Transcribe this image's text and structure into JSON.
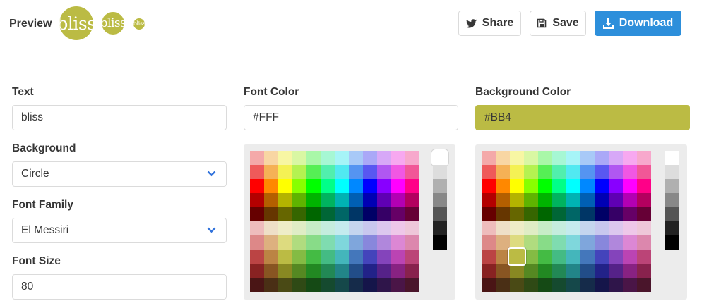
{
  "header": {
    "preview_label": "Preview",
    "avatar_text": "bliss",
    "share_label": "Share",
    "save_label": "Save",
    "download_label": "Download"
  },
  "text": {
    "label": "Text",
    "value": "bliss"
  },
  "background": {
    "label": "Background",
    "value": "Circle"
  },
  "font_family": {
    "label": "Font Family",
    "value": "El Messiri"
  },
  "font_size": {
    "label": "Font Size",
    "value": "80"
  },
  "font_color": {
    "label": "Font Color",
    "value": "#FFF"
  },
  "background_color": {
    "label": "Background Color",
    "value": "#BB4"
  },
  "colors": {
    "avatar_bg": "#bbbb44",
    "avatar_fg": "#ffffff",
    "download_button": "#2d8fdb"
  },
  "icons": {
    "share": "twitter-icon",
    "save": "floppy-disk-icon",
    "download": "download-icon",
    "select": "chevron-down-icon"
  },
  "palette": {
    "rows": [
      [
        "#f4a9a9",
        "#f8d6a3",
        "#f7f6a3",
        "#d9f7a3",
        "#a9f7a8",
        "#a6f7d4",
        "#a6f4f7",
        "#a8c9f7",
        "#aaa8f7",
        "#d7a8f7",
        "#f7a8f0",
        "#f7a8cc"
      ],
      [
        "#ef5a5a",
        "#f5b156",
        "#f4f154",
        "#b4f251",
        "#56ef55",
        "#51efad",
        "#51e9f1",
        "#5594f1",
        "#5957f1",
        "#b057f1",
        "#f157e3",
        "#f15797"
      ],
      [
        "#ff0000",
        "#ff8800",
        "#ffff00",
        "#88ff00",
        "#00ff00",
        "#00ff88",
        "#00ffff",
        "#0088ff",
        "#0000ff",
        "#8800ff",
        "#ff00ff",
        "#ff0088"
      ],
      [
        "#b30000",
        "#b35f00",
        "#b3b300",
        "#5fb300",
        "#00b300",
        "#00b35f",
        "#00b3b3",
        "#005fb3",
        "#0000b3",
        "#5f00b3",
        "#b300b3",
        "#b3005f"
      ],
      [
        "#660000",
        "#663600",
        "#666600",
        "#366600",
        "#006600",
        "#006636",
        "#006666",
        "#003666",
        "#000066",
        "#360066",
        "#660066",
        "#660036"
      ],
      [
        "#eebcbc",
        "#eedfc7",
        "#eeedc7",
        "#dfedc5",
        "#c7edc7",
        "#c5edde",
        "#c5ebee",
        "#c5d5ee",
        "#c8c7ee",
        "#dcc7ee",
        "#eec7e9",
        "#eec7d9"
      ],
      [
        "#dd8888",
        "#ddb07f",
        "#dddb7f",
        "#b0dc7f",
        "#88dc88",
        "#7fdcb0",
        "#7fd7dc",
        "#7fa6dc",
        "#8887dc",
        "#b087dc",
        "#dc87d4",
        "#dc87ad"
      ],
      [
        "#bb4444",
        "#bb8444",
        "#bbbb44",
        "#84bb44",
        "#44bb44",
        "#44bb84",
        "#44b6bb",
        "#4477bb",
        "#4444bb",
        "#8444bb",
        "#bb44b3",
        "#bb4477"
      ],
      [
        "#882222",
        "#885522",
        "#888822",
        "#558822",
        "#228822",
        "#228855",
        "#228588",
        "#224d88",
        "#222288",
        "#552288",
        "#882282",
        "#88224d"
      ],
      [
        "#4a1515",
        "#4a2f15",
        "#4a4a15",
        "#2f4a15",
        "#154a15",
        "#154a2f",
        "#15484a",
        "#152b4a",
        "#15154a",
        "#2f154a",
        "#4a1547",
        "#4a152b"
      ]
    ],
    "grays": [
      "#ffffff",
      "#dddddd",
      "#b0b0b0",
      "#888888",
      "#555555",
      "#222222",
      "#000000"
    ]
  }
}
